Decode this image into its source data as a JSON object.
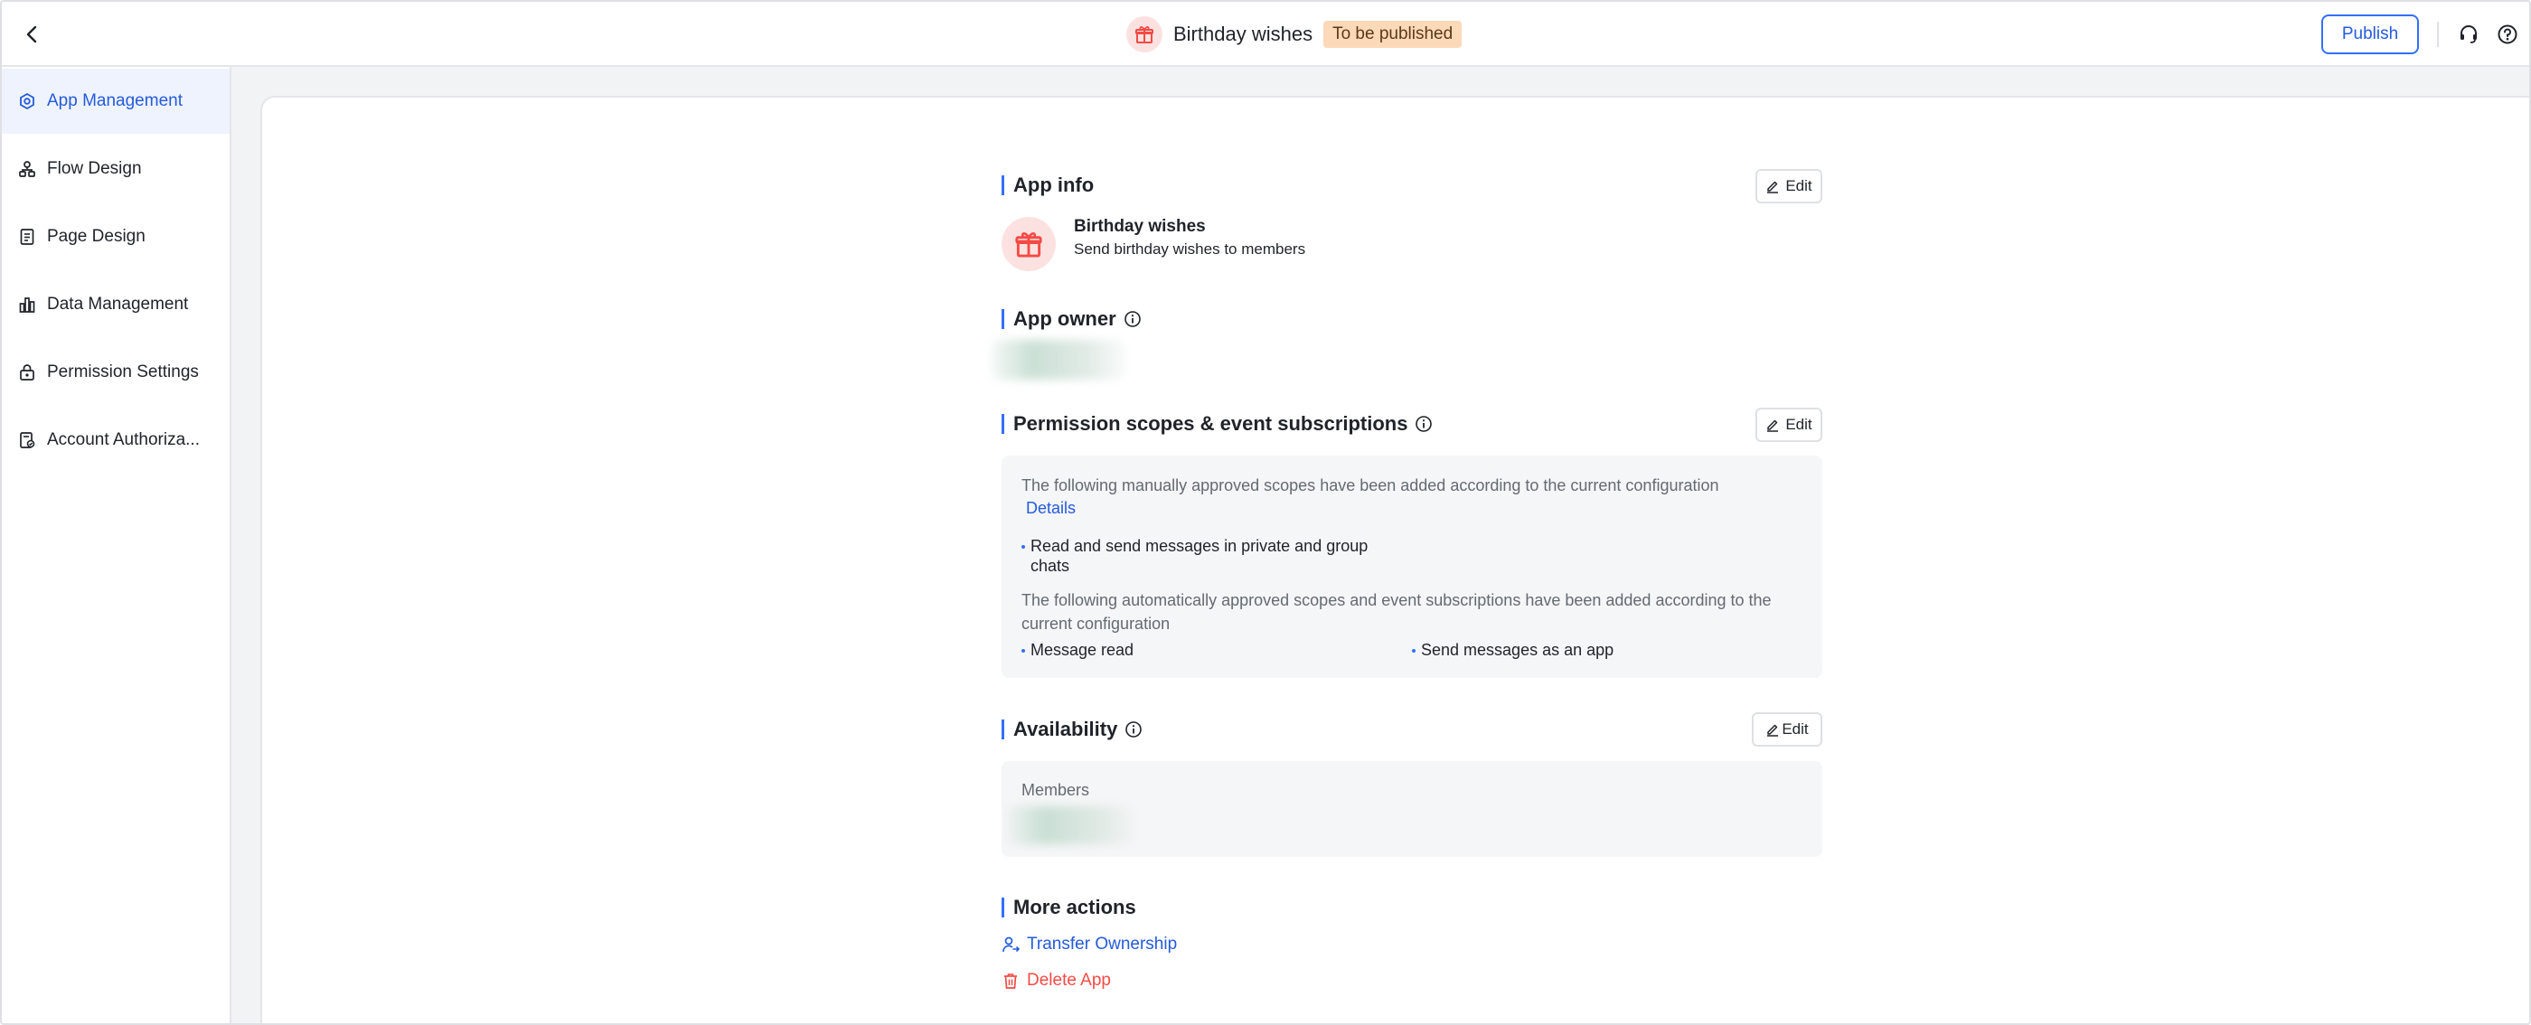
{
  "header": {
    "title": "Birthday wishes",
    "status": "To be published",
    "publish_label": "Publish"
  },
  "sidebar": {
    "items": [
      {
        "label": "App Management",
        "icon": "gear-icon",
        "active": true
      },
      {
        "label": "Flow Design",
        "icon": "flow-icon",
        "active": false
      },
      {
        "label": "Page Design",
        "icon": "page-icon",
        "active": false
      },
      {
        "label": "Data Management",
        "icon": "chart-icon",
        "active": false
      },
      {
        "label": "Permission Settings",
        "icon": "lock-icon",
        "active": false
      },
      {
        "label": "Account Authoriza...",
        "icon": "account-icon",
        "active": false
      }
    ]
  },
  "app_info": {
    "title": "App info",
    "edit_label": "Edit",
    "name": "Birthday wishes",
    "description": "Send birthday wishes to members"
  },
  "app_owner": {
    "title": "App owner"
  },
  "permissions": {
    "title": "Permission scopes & event subscriptions",
    "edit_label": "Edit",
    "manual_text": "The following manually approved scopes have been added according to the current configuration",
    "details_link": "Details",
    "manual_scopes": [
      "Read and send messages in private and group chats"
    ],
    "auto_text": "The following automatically approved scopes and event subscriptions have been added according to the current configuration",
    "auto_scopes": [
      "Message read",
      "Send messages as an app"
    ]
  },
  "availability": {
    "title": "Availability",
    "edit_label": "Edit",
    "members_label": "Members"
  },
  "more_actions": {
    "title": "More actions",
    "transfer_label": "Transfer Ownership",
    "delete_label": "Delete App"
  },
  "colors": {
    "accent": "#3370ff",
    "link": "#245bdb",
    "danger": "#f54a45",
    "badge_bg": "#fcd9b8",
    "active_bg": "#eff3fe"
  }
}
